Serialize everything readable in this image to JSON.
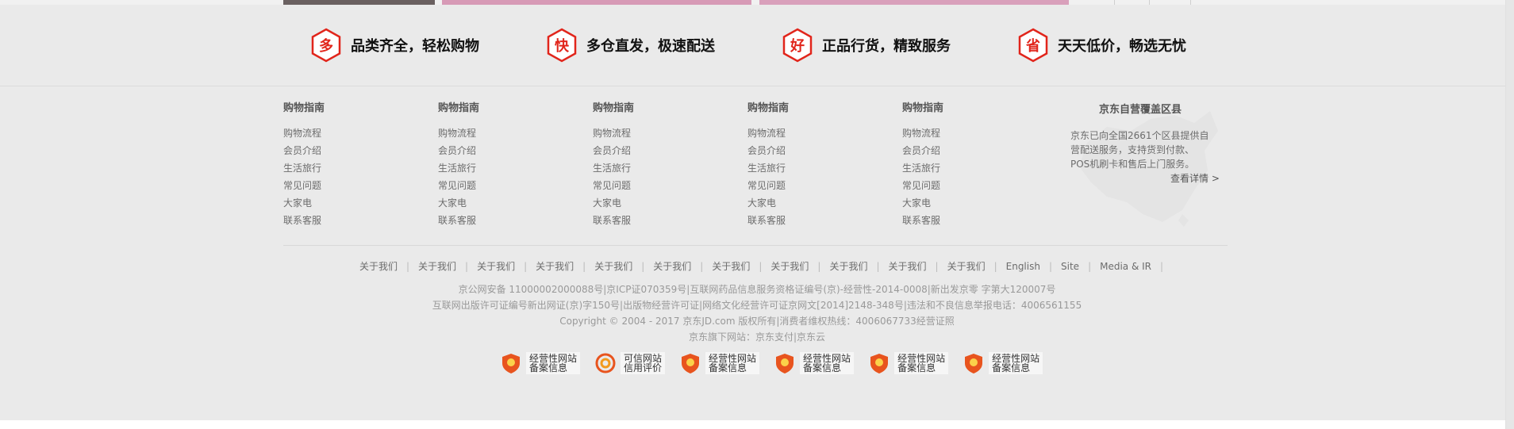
{
  "services": [
    {
      "glyph": "多",
      "text": "品类齐全，轻松购物"
    },
    {
      "glyph": "快",
      "text": "多仓直发，极速配送"
    },
    {
      "glyph": "好",
      "text": "正品行货，精致服务"
    },
    {
      "glyph": "省",
      "text": "天天低价，畅选无忧"
    }
  ],
  "columns": [
    {
      "title": "购物指南",
      "links": [
        "购物流程",
        "会员介绍",
        "生活旅行",
        "常见问题",
        "大家电",
        "联系客服"
      ]
    },
    {
      "title": "购物指南",
      "links": [
        "购物流程",
        "会员介绍",
        "生活旅行",
        "常见问题",
        "大家电",
        "联系客服"
      ]
    },
    {
      "title": "购物指南",
      "links": [
        "购物流程",
        "会员介绍",
        "生活旅行",
        "常见问题",
        "大家电",
        "联系客服"
      ]
    },
    {
      "title": "购物指南",
      "links": [
        "购物流程",
        "会员介绍",
        "生活旅行",
        "常见问题",
        "大家电",
        "联系客服"
      ]
    },
    {
      "title": "购物指南",
      "links": [
        "购物流程",
        "会员介绍",
        "生活旅行",
        "常见问题",
        "大家电",
        "联系客服"
      ]
    }
  ],
  "coverage": {
    "title": "京东自营覆盖区县",
    "lines": [
      "京东已向全国2661个区县提供自",
      "营配送服务，支持货到付款、",
      "POS机刷卡和售后上门服务。"
    ],
    "more": "查看详情 >"
  },
  "footer_links": [
    "关于我们",
    "关于我们",
    "关于我们",
    "关于我们",
    "关于我们",
    "关于我们",
    "关于我们",
    "关于我们",
    "关于我们",
    "关于我们",
    "关于我们",
    "English",
    "Site",
    "Media & IR"
  ],
  "info_lines": [
    "京公网安备 11000002000088号|京ICP证070359号|互联网药品信息服务资格证编号(京)-经营性-2014-0008|新出发京零 字第大120007号",
    "互联网出版许可证编号新出网证(京)字150号|出版物经营许可证|网络文化经营许可证京网文[2014]2148-348号|违法和不良信息举报电话：4006561155",
    "Copyright © 2004 - 2017 京东JD.com 版权所有|消费者维权热线：4006067733经营证照",
    "京东旗下网站：京东支付|京东云"
  ],
  "badges": [
    {
      "icon": "license-shield-icon",
      "line1": "经营性网站",
      "line2": "备案信息"
    },
    {
      "icon": "credit-rating-icon",
      "line1": "可信网站",
      "line2": "信用评价"
    },
    {
      "icon": "license-shield-icon",
      "line1": "经营性网站",
      "line2": "备案信息"
    },
    {
      "icon": "license-shield-icon",
      "line1": "经营性网站",
      "line2": "备案信息"
    },
    {
      "icon": "license-shield-icon",
      "line1": "经营性网站",
      "line2": "备案信息"
    },
    {
      "icon": "license-shield-icon",
      "line1": "经营性网站",
      "line2": "备案信息"
    }
  ],
  "colors": {
    "accent": "#e1251b",
    "background": "#eaeaea"
  }
}
